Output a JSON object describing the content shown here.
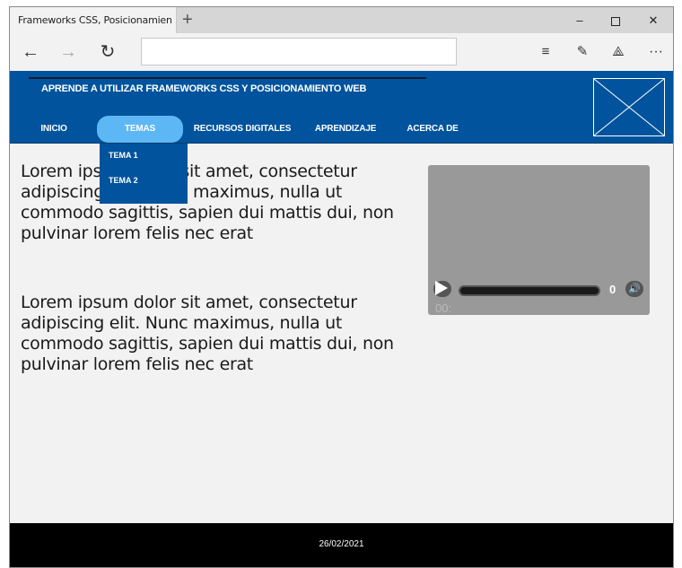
{
  "browser": {
    "tab_title": "Frameworks CSS, Posicionamiento web",
    "new_tab": "+",
    "min": "–",
    "close": "✕",
    "back": "←",
    "forward": "→",
    "refresh": "↻",
    "address_value": "",
    "reading_view": "≡",
    "notes": "✎",
    "share": "⟁",
    "more": "···"
  },
  "site": {
    "title": "APRENDE A UTILIZAR FRAMEWORKS CSS Y POSICIONAMIENTO WEB",
    "header_color": "#00539c",
    "active_color": "#5eb7f5",
    "menu": [
      "INICIO",
      "TEMAS",
      "RECURSOS DIGITALES",
      "APRENDIZAJE",
      "ACERCA DE"
    ],
    "active_menu": "TEMAS",
    "dropdown": [
      "TEMA 1",
      "TEMA 2"
    ]
  },
  "content": {
    "paragraph_1": "Lorem ipsum dolor sit amet, consectetur adipiscing elit. Nunc maximus, nulla ut commodo sagittis, sapien dui mattis dui, non pulvinar lorem felis nec erat",
    "paragraph_2": "Lorem ipsum dolor sit amet, consectetur adipiscing elit. Nunc maximus, nulla ut commodo sagittis, sapien dui mattis dui, non pulvinar lorem felis nec erat",
    "video": {
      "time_inline": "0",
      "time_below": "00:"
    }
  },
  "footer": {
    "date": "26/02/2021"
  }
}
